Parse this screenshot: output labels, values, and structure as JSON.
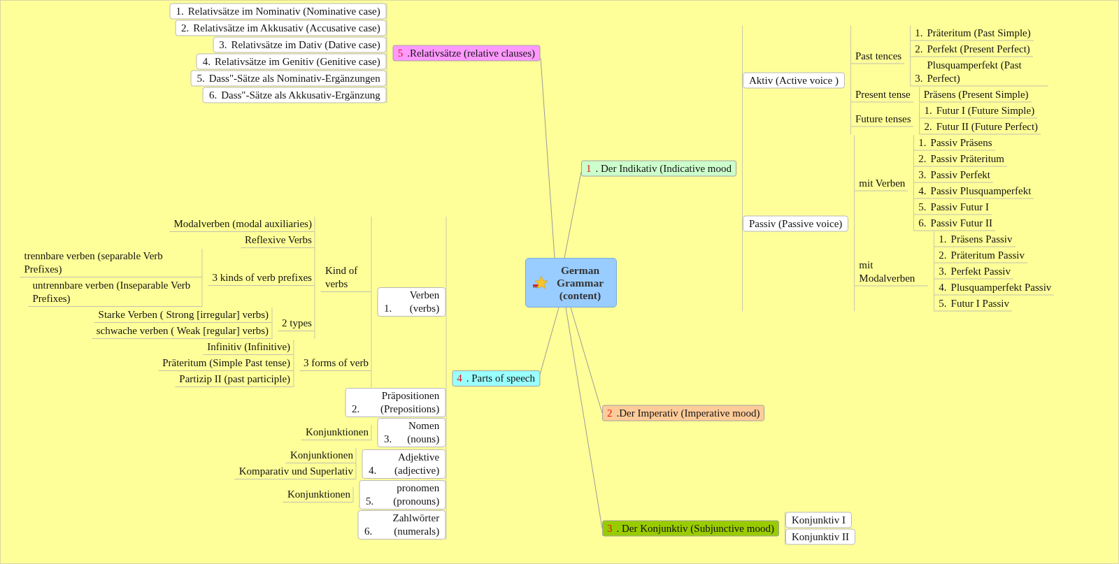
{
  "map": {
    "root": {
      "title": "German Grammar (content)"
    },
    "branches": [
      {
        "number": "5",
        "label": ".Relativsätze (relative clauses)",
        "color": "#ff99ff",
        "children": [
          {
            "number": "1.",
            "label": "Relativsätze im Nominativ (Nominative case)"
          },
          {
            "number": "2.",
            "label": "Relativsätze im Akkusativ (Accusative case)"
          },
          {
            "number": "3.",
            "label": "Relativsätze im Dativ (Dative case)"
          },
          {
            "number": "4.",
            "label": "Relativsätze im Genitiv (Genitive case)"
          },
          {
            "number": "5.",
            "label": "Dass\"-Sätze als Nominativ-Ergänzungen"
          },
          {
            "number": "6.",
            "label": "Dass\"-Sätze als Akkusativ-Ergänzung"
          }
        ]
      },
      {
        "number": "1",
        "label": ". Der Indikativ (Indicative mood",
        "color": "#ccffcc",
        "children": [
          {
            "label": "Aktiv (Active voice )",
            "children": [
              {
                "label": "Past tences",
                "children": [
                  {
                    "number": "1.",
                    "label": "Präteritum (Past Simple)"
                  },
                  {
                    "number": "2.",
                    "label": "Perfekt (Present Perfect)"
                  },
                  {
                    "number": "3.",
                    "label": "Plusquamperfekt (Past Perfect)"
                  }
                ]
              },
              {
                "label": "Present tense",
                "children": [
                  {
                    "label": "Präsens (Present Simple)"
                  }
                ]
              },
              {
                "label": "Future tenses",
                "children": [
                  {
                    "number": "1.",
                    "label": "Futur I (Future Simple)"
                  },
                  {
                    "number": "2.",
                    "label": "Futur II (Future Perfect)"
                  }
                ]
              }
            ]
          },
          {
            "label": "Passiv (Passive voice)",
            "children": [
              {
                "label": "mit Verben",
                "children": [
                  {
                    "number": "1.",
                    "label": "Passiv Präsens"
                  },
                  {
                    "number": "2.",
                    "label": "Passiv Präteritum"
                  },
                  {
                    "number": "3.",
                    "label": "Passiv Perfekt"
                  },
                  {
                    "number": "4.",
                    "label": "Passiv Plusquamperfekt"
                  },
                  {
                    "number": "5.",
                    "label": "Passiv Futur I"
                  },
                  {
                    "number": "6.",
                    "label": "Passiv Futur II"
                  }
                ]
              },
              {
                "label": "mit Modalverben",
                "children": [
                  {
                    "number": "1.",
                    "label": "Präsens Passiv"
                  },
                  {
                    "number": "2.",
                    "label": "Präteritum Passiv"
                  },
                  {
                    "number": "3.",
                    "label": "Perfekt Passiv"
                  },
                  {
                    "number": "4.",
                    "label": "Plusquamperfekt Passiv"
                  },
                  {
                    "number": "5.",
                    "label": "Futur I Passiv"
                  }
                ]
              }
            ]
          }
        ]
      },
      {
        "number": "4",
        "label": ". Parts of speech",
        "color": "#99ffff",
        "children": [
          {
            "number": "1.",
            "label": "Verben (verbs)",
            "children": [
              {
                "label": "Kind of verbs",
                "children": [
                  {
                    "label": "Modalverben (modal auxiliaries)"
                  },
                  {
                    "label": "Reflexive Verbs"
                  },
                  {
                    "label": "3 kinds of verb prefixes",
                    "children": [
                      {
                        "label": "trennbare verben (separable Verb Prefixes)"
                      },
                      {
                        "label": "untrennbare verben (Inseparable Verb Prefixes)"
                      }
                    ]
                  },
                  {
                    "label": "2 types",
                    "children": [
                      {
                        "label": "Starke Verben ( Strong [irregular] verbs)"
                      },
                      {
                        "label": "schwache verben ( Weak [regular] verbs)"
                      }
                    ]
                  }
                ]
              },
              {
                "label": "3 forms of verb",
                "children": [
                  {
                    "label": "Infinitiv (Infinitive)"
                  },
                  {
                    "label": "Präteritum (Simple Past tense)"
                  },
                  {
                    "label": "Partizip II  (past participle)"
                  }
                ]
              }
            ]
          },
          {
            "number": "2.",
            "label": "Präpositionen (Prepositions)"
          },
          {
            "number": "3.",
            "label": "Nomen (nouns)",
            "children": [
              {
                "label": "Konjunktionen"
              }
            ]
          },
          {
            "number": "4.",
            "label": "Adjektive (adjective)",
            "children": [
              {
                "label": "Konjunktionen"
              },
              {
                "label": "Komparativ und Superlativ"
              }
            ]
          },
          {
            "number": "5.",
            "label": "pronomen (pronouns)",
            "children": [
              {
                "label": "Konjunktionen"
              }
            ]
          },
          {
            "number": "6.",
            "label": "Zahlwörter (numerals)"
          }
        ]
      },
      {
        "number": "2",
        "label": ".Der Imperativ (Imperative mood)",
        "color": "#ffcc99"
      },
      {
        "number": "3",
        "label": ". Der Konjunktiv (Subjunctive mood)",
        "color": "#99cc00",
        "children": [
          {
            "label": "Konjunktiv I"
          },
          {
            "label": "Konjunktiv II"
          }
        ]
      }
    ]
  }
}
